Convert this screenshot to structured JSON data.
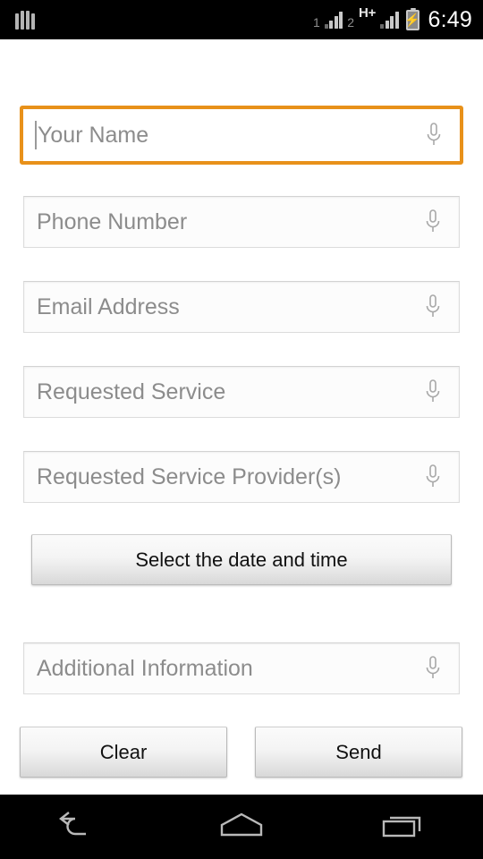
{
  "status_bar": {
    "left_icon": "equalizer-bars-icon",
    "sim1_label": "1",
    "sim1_signal_icon": "signal-bars-icon",
    "sim2_label": "2",
    "network_type": "H+",
    "sim2_signal_icon": "signal-bars-icon",
    "battery_icon": "battery-charging-icon",
    "battery_bolt": "⚡",
    "time": "6:49"
  },
  "form": {
    "fields": [
      {
        "placeholder": "Your Name",
        "value": "",
        "focused": true,
        "mic_icon": "microphone-icon"
      },
      {
        "placeholder": "Phone Number",
        "value": "",
        "focused": false,
        "mic_icon": "microphone-icon"
      },
      {
        "placeholder": "Email Address",
        "value": "",
        "focused": false,
        "mic_icon": "microphone-icon"
      },
      {
        "placeholder": "Requested Service",
        "value": "",
        "focused": false,
        "mic_icon": "microphone-icon"
      },
      {
        "placeholder": "Requested Service Provider(s)",
        "value": "",
        "focused": false,
        "mic_icon": "microphone-icon"
      },
      {
        "placeholder": "Additional Information",
        "value": "",
        "focused": false,
        "mic_icon": "microphone-icon"
      }
    ],
    "date_time_button": "Select the date and time",
    "clear_button": "Clear",
    "send_button": "Send"
  },
  "nav_bar": {
    "back": "back-icon",
    "home": "home-icon",
    "recents": "recents-icon"
  },
  "colors": {
    "focus_accent": "#e8911a",
    "status_bar_bg": "#000000",
    "page_bg": "#ffffff",
    "placeholder_text": "#8c8c8c",
    "button_text": "#111111"
  }
}
